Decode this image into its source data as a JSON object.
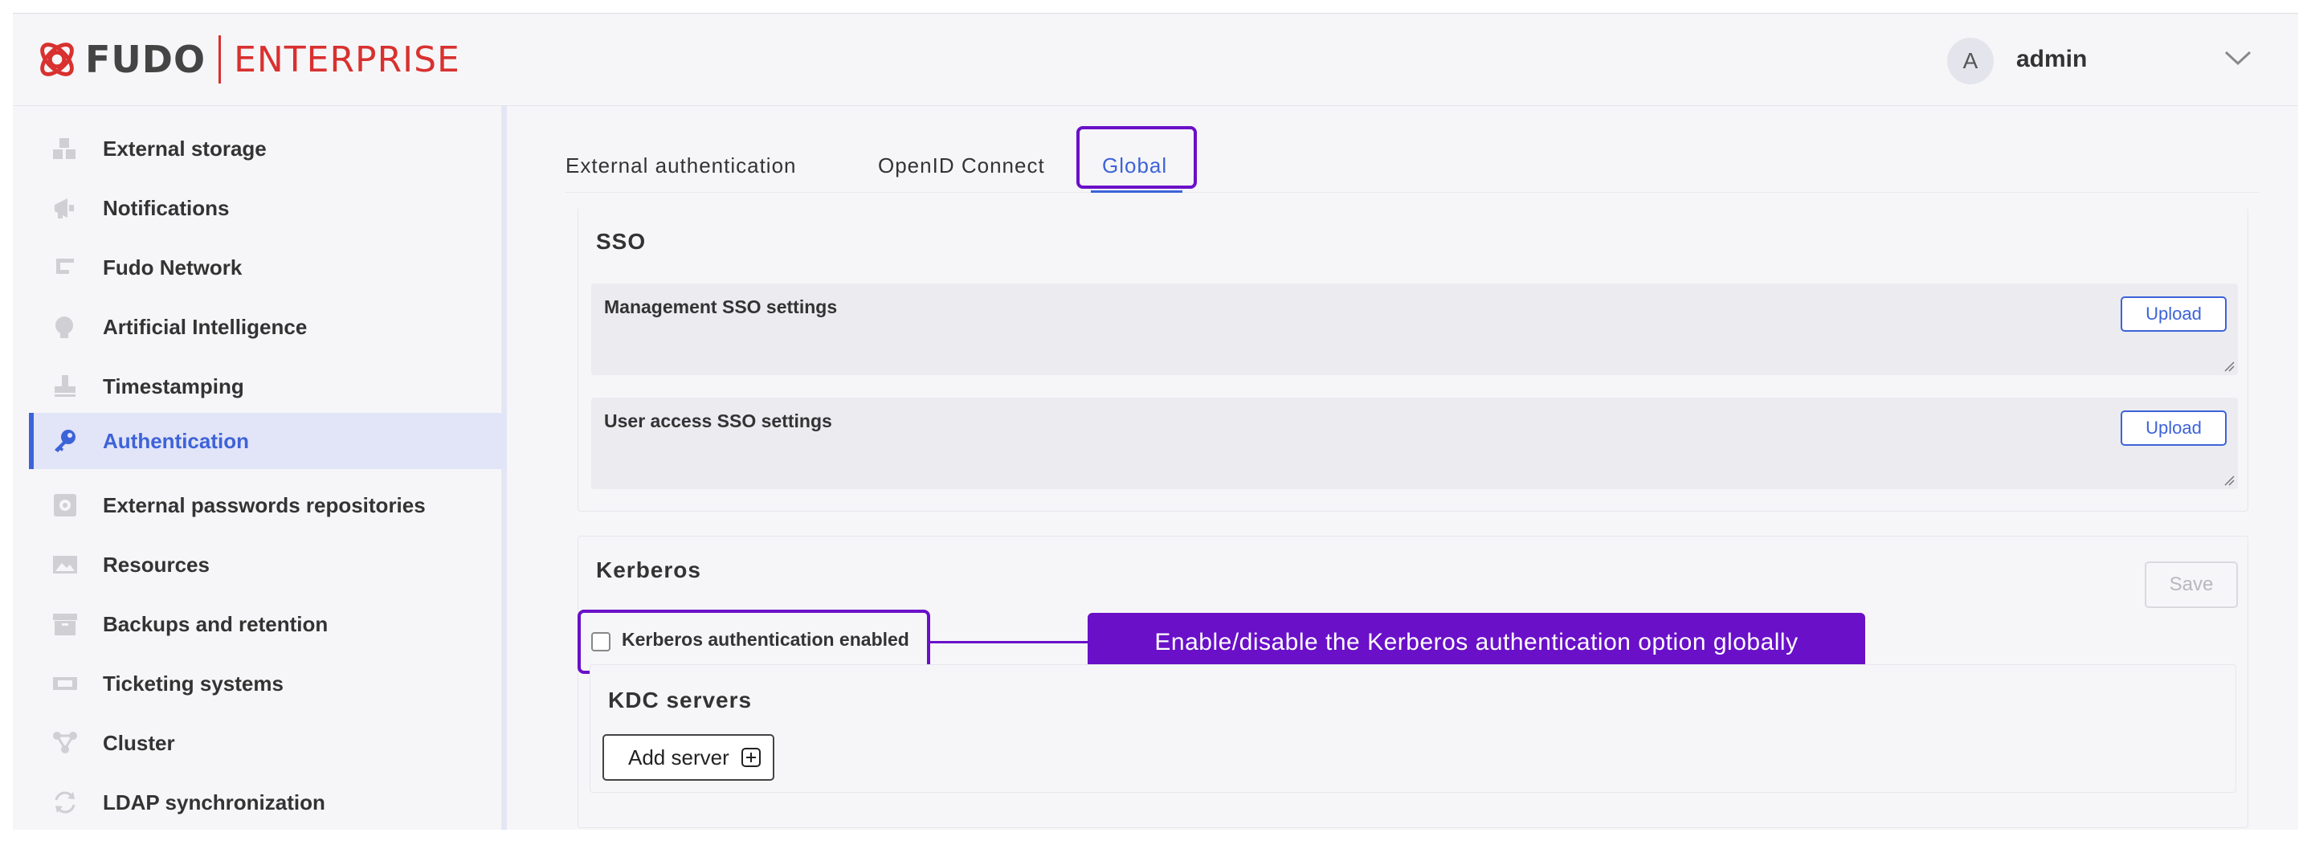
{
  "header": {
    "brand": "FUDO",
    "edition": "ENTERPRISE",
    "user_initial": "A",
    "user_name": "admin"
  },
  "sidebar": {
    "items": [
      {
        "label": "External storage",
        "icon": "storage-icon"
      },
      {
        "label": "Notifications",
        "icon": "megaphone-icon"
      },
      {
        "label": "Fudo Network",
        "icon": "network-icon"
      },
      {
        "label": "Artificial Intelligence",
        "icon": "brain-icon"
      },
      {
        "label": "Timestamping",
        "icon": "stamp-icon"
      },
      {
        "label": "Authentication",
        "icon": "key-icon",
        "active": true
      },
      {
        "label": "External passwords repositories",
        "icon": "safe-icon"
      },
      {
        "label": "Resources",
        "icon": "image-icon"
      },
      {
        "label": "Backups and retention",
        "icon": "archive-icon"
      },
      {
        "label": "Ticketing systems",
        "icon": "ticket-icon"
      },
      {
        "label": "Cluster",
        "icon": "cluster-icon"
      },
      {
        "label": "LDAP synchronization",
        "icon": "sync-icon"
      }
    ]
  },
  "tabs": [
    {
      "label": "External authentication"
    },
    {
      "label": "OpenID Connect"
    },
    {
      "label": "Global",
      "active": true
    }
  ],
  "sso": {
    "title": "SSO",
    "management_label": "Management SSO settings",
    "user_access_label": "User access SSO settings",
    "upload_label": "Upload"
  },
  "kerberos": {
    "title": "Kerberos",
    "save_label": "Save",
    "enabled_label": "Kerberos authentication enabled",
    "enabled": false,
    "kdc_title": "KDC servers",
    "add_server_label": "Add server"
  },
  "callout": {
    "text": "Enable/disable the Kerberos authentication option globally"
  },
  "colors": {
    "accent": "#3d63d8",
    "brand_red": "#d8312f",
    "highlight": "#6a10c8"
  }
}
